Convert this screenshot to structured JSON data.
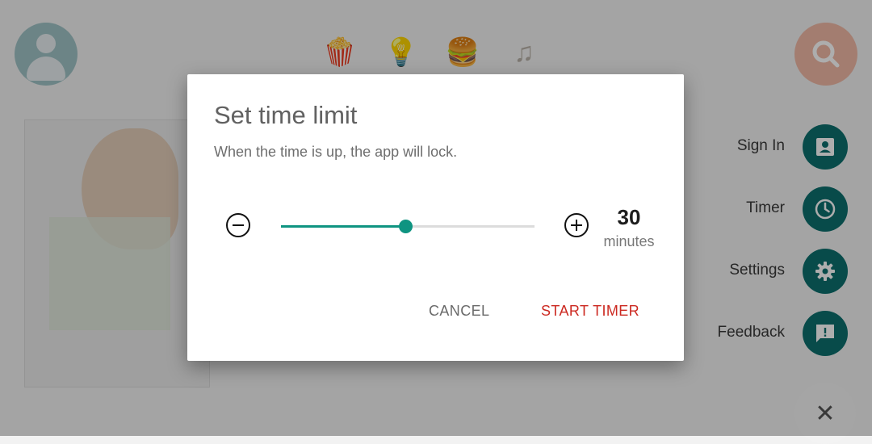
{
  "dialog": {
    "title": "Set time limit",
    "subtitle": "When the time is up, the app will lock.",
    "value": "30",
    "unit": "minutes",
    "slider_fraction": 0.49,
    "cancel_label": "CANCEL",
    "start_label": "START TIMER"
  },
  "menu": {
    "items": [
      {
        "label": "Sign In",
        "icon": "account-box-icon"
      },
      {
        "label": "Timer",
        "icon": "clock-icon"
      },
      {
        "label": "Settings",
        "icon": "gear-icon"
      },
      {
        "label": "Feedback",
        "icon": "feedback-icon"
      }
    ],
    "close_glyph": "✕"
  },
  "colors": {
    "accent": "#0f9481",
    "fab": "#0d6f6d",
    "start_button": "#cc2a22"
  }
}
